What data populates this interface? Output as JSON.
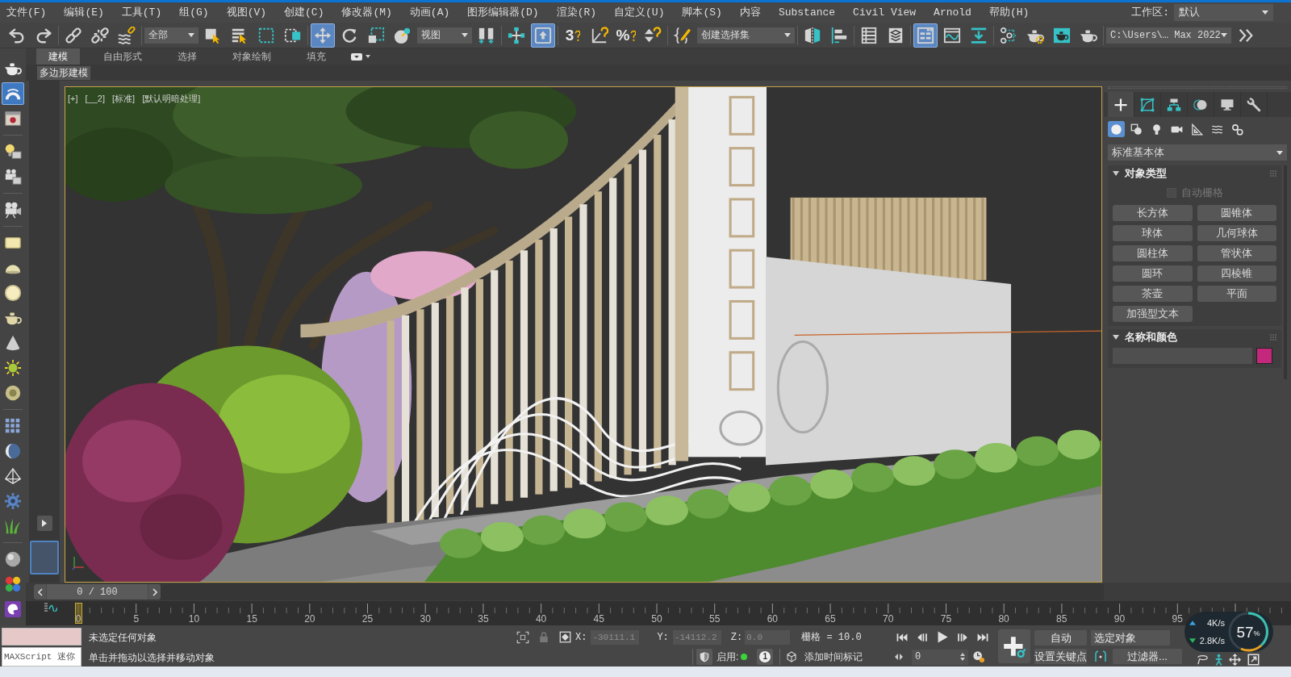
{
  "menu_bar": {
    "items": [
      "文件(F)",
      "编辑(E)",
      "工具(T)",
      "组(G)",
      "视图(V)",
      "创建(C)",
      "修改器(M)",
      "动画(A)",
      "图形编辑器(D)",
      "渲染(R)",
      "自定义(U)",
      "脚本(S)",
      "内容",
      "Substance",
      "Civil View",
      "Arnold",
      "帮助(H)"
    ],
    "workspace_label": "工作区:",
    "workspace": "默认"
  },
  "main_toolbar": [
    {
      "kind": "button",
      "selected": false
    },
    {
      "kind": "button",
      "selected": false
    },
    {
      "kind": "button",
      "selected": false
    },
    {
      "kind": "button",
      "selected": false
    },
    {
      "kind": "button",
      "selected": false
    },
    {
      "kind": "dropdown",
      "value": "全部"
    },
    {
      "kind": "button",
      "selected": false
    },
    {
      "kind": "button",
      "selected": false
    },
    {
      "kind": "button",
      "selected": false
    },
    {
      "kind": "button",
      "selected": false
    },
    {
      "kind": "button",
      "selected": true
    },
    {
      "kind": "button",
      "selected": false
    },
    {
      "kind": "button",
      "selected": false
    },
    {
      "kind": "button",
      "selected": false
    },
    {
      "kind": "dropdown",
      "value": "视图"
    },
    {
      "kind": "button",
      "selected": false
    },
    {
      "kind": "button",
      "selected": false
    },
    {
      "kind": "button",
      "selected": true
    },
    {
      "kind": "glyph",
      "text": "3",
      "selected": false
    },
    {
      "kind": "button",
      "selected": false
    },
    {
      "kind": "glyph",
      "text": "%",
      "selected": false
    },
    {
      "kind": "button",
      "selected": false
    },
    {
      "kind": "button",
      "selected": false
    },
    {
      "kind": "dropdown",
      "value": "创建选择集"
    },
    {
      "kind": "button",
      "selected": false
    },
    {
      "kind": "button",
      "selected": false
    },
    {
      "kind": "button",
      "selected": false
    },
    {
      "kind": "button",
      "selected": false
    },
    {
      "kind": "button",
      "selected": true
    },
    {
      "kind": "button",
      "selected": false
    },
    {
      "kind": "button",
      "selected": false
    },
    {
      "kind": "button",
      "selected": false
    },
    {
      "kind": "button",
      "selected": false
    },
    {
      "kind": "button",
      "selected": false
    },
    {
      "kind": "button",
      "selected": false
    },
    {
      "kind": "dropdown",
      "value": "C:\\Users\\… Max 2022"
    },
    {
      "kind": "button",
      "selected": false
    }
  ],
  "ribbon": {
    "tabs": [
      {
        "label": "建模",
        "selected": true
      },
      {
        "label": "自由形式",
        "selected": false
      },
      {
        "label": "选择",
        "selected": false
      },
      {
        "label": "对象绘制",
        "selected": false
      },
      {
        "label": "填充",
        "selected": false
      }
    ],
    "panel_tab": "多边形建模"
  },
  "create_toolbar": [
    {
      "selected": false
    },
    {
      "selected": true
    },
    {
      "selected": false
    },
    {
      "selected": false
    },
    {
      "selected": false
    },
    {
      "selected": false
    },
    {
      "selected": false
    },
    {
      "selected": false
    },
    {
      "selected": false
    },
    {
      "selected": false
    },
    {
      "selected": false
    },
    {
      "selected": false
    },
    {
      "selected": false
    },
    {
      "selected": false
    },
    {
      "selected": false
    },
    {
      "selected": false
    },
    {
      "selected": false
    },
    {
      "selected": false
    },
    {
      "selected": false
    },
    {
      "selected": false
    },
    {
      "selected": false
    }
  ],
  "viewport": {
    "labels": [
      "[+]",
      "[__2]",
      "[标准]",
      "[默认明暗处理]"
    ]
  },
  "command_panel": {
    "tabs": [
      {
        "selected": true
      },
      {
        "selected": false
      },
      {
        "selected": false
      },
      {
        "selected": false
      },
      {
        "selected": false
      },
      {
        "selected": false
      }
    ],
    "categories": [
      {
        "selected": true
      },
      {
        "selected": false
      },
      {
        "selected": false
      },
      {
        "selected": false
      },
      {
        "selected": false
      },
      {
        "selected": false
      },
      {
        "selected": false
      }
    ],
    "object_category": "标准基本体",
    "rollouts": [
      {
        "kind": "object_type",
        "title": "对象类型",
        "expanded": true,
        "auto_grid": {
          "label": "自动栅格",
          "checked": false,
          "disabled": true
        },
        "buttons": [
          "长方体",
          "圆锥体",
          "球体",
          "几何球体",
          "圆柱体",
          "管状体",
          "圆环",
          "四棱锥",
          "茶壶",
          "平面",
          "加强型文本"
        ]
      },
      {
        "kind": "name_color",
        "title": "名称和颜色",
        "expanded": true,
        "color": "#c4287c"
      }
    ]
  },
  "time_slider": {
    "label": "0 / 100",
    "level": 0
  },
  "track_bar": {
    "ticks": [
      "0",
      "5",
      "10",
      "15",
      "20",
      "25",
      "30",
      "35",
      "40",
      "45",
      "50",
      "55",
      "60",
      "65",
      "70",
      "75",
      "80",
      "85",
      "90",
      "95"
    ]
  },
  "status_bar": {
    "listener_placeholder": "MAXScript 迷你",
    "messages": [
      "未选定任何对象",
      "单击并拖动以选择并移动对象"
    ],
    "coordinates": [
      {
        "label": "X:",
        "value": "-30111.1",
        "disabled": true
      },
      {
        "label": "Y:",
        "value": "-14112.2",
        "disabled": true
      },
      {
        "label": "Z:",
        "value": "0.0",
        "disabled": true
      }
    ],
    "grid": "栅格 = 10.0",
    "time_tag": {
      "label": "启用:",
      "on": true,
      "count": "1",
      "add": "添加时间标记"
    },
    "frame": "0",
    "auto_key": "自动",
    "set_key": "设置关键点",
    "key_target": "选定对象",
    "filters": "过滤器..."
  },
  "network_monitor": {
    "upload": "4K/s",
    "download": "2.8K/s",
    "value": "57",
    "unit": "%"
  }
}
